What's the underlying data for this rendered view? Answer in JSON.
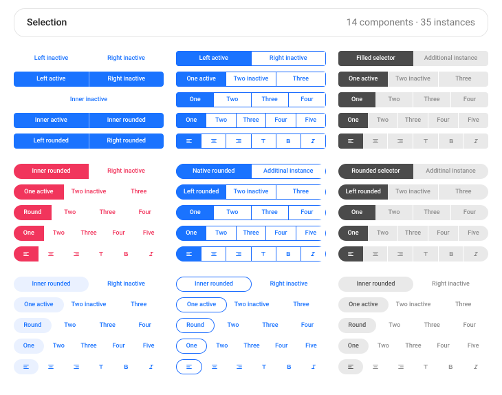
{
  "header": {
    "title": "Selection",
    "meta": "14 components · 35 instances"
  },
  "labels": {
    "leftInactive": "Left inactive",
    "rightInactive": "Right inactive",
    "leftActive": "Left active",
    "innerInactive": "Inner inactive",
    "innerActive": "Inner active",
    "innerRounded": "Inner rounded",
    "leftRounded": "Left rounded",
    "rightRounded": "Right rounded",
    "oneActive": "One active",
    "twoInactive": "Two inactive",
    "three": "Three",
    "round": "Round",
    "one": "One",
    "two": "Two",
    "four": "Four",
    "five": "Five",
    "filledSelector": "Filled selector",
    "additionalInstance": "Additional instance",
    "nativeRounded": "Native rounded",
    "additinalInstance": "Additinal instance",
    "roundedSelector": "Rounded selector"
  }
}
